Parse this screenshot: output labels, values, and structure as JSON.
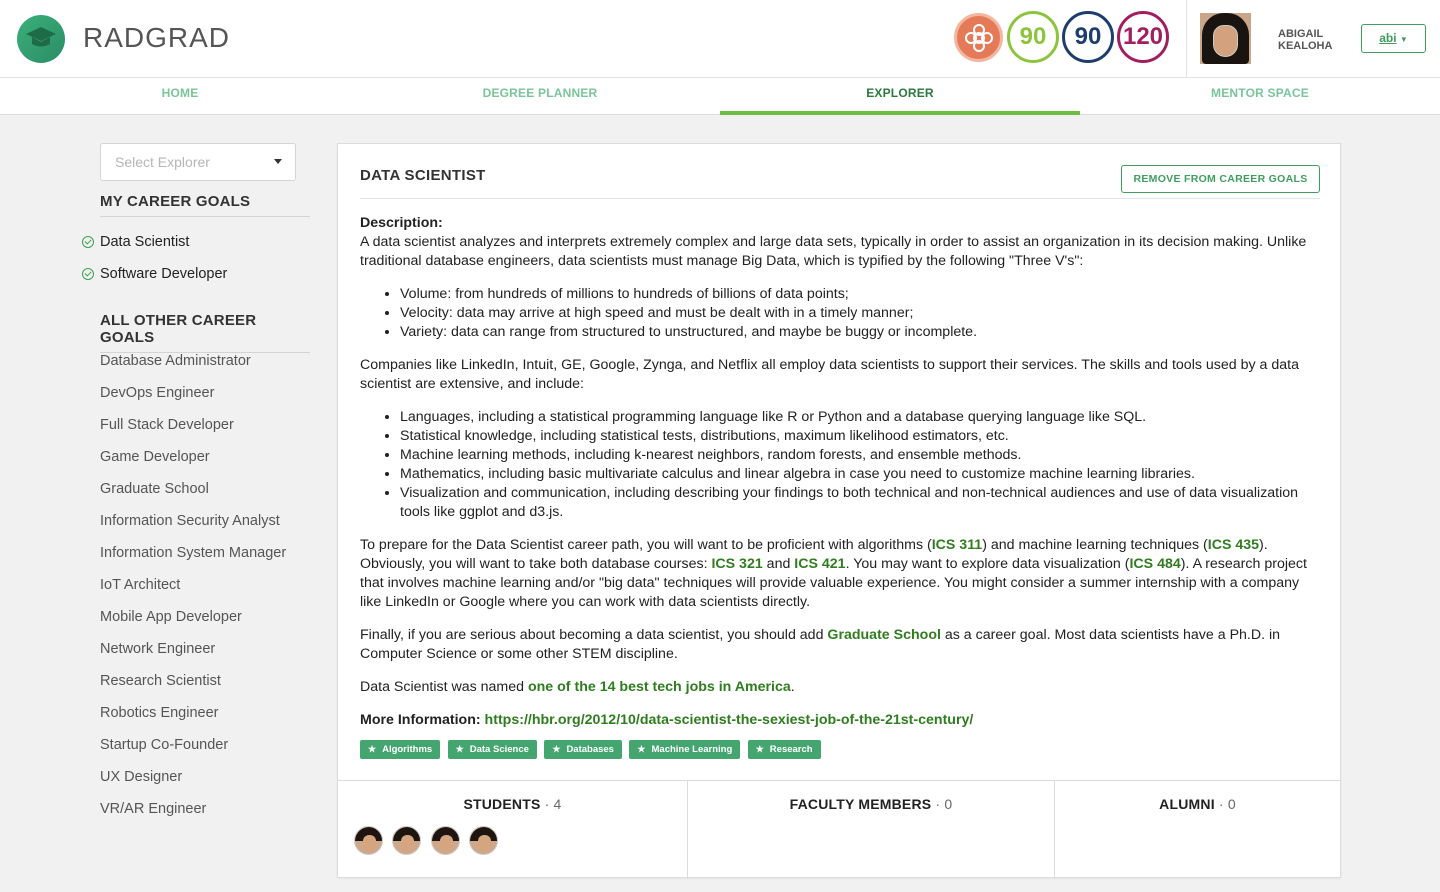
{
  "app": {
    "brand": "RADGRAD",
    "ice": {
      "innovation": "90",
      "competency": "90",
      "experience": "120"
    },
    "user": {
      "name": "ABIGAIL KEALOHA",
      "button": "abi"
    },
    "colors": {
      "accent": "#6fbe44",
      "link": "#2f7d1f",
      "innovation": "#8dc43c",
      "competency": "#1c3d6e",
      "experience": "#a21f5f"
    }
  },
  "nav": [
    {
      "label": "HOME"
    },
    {
      "label": "DEGREE PLANNER"
    },
    {
      "label": "EXPLORER"
    },
    {
      "label": "MENTOR SPACE"
    }
  ],
  "sidebar": {
    "select_placeholder": "Select Explorer",
    "my_goals_heading": "MY CAREER GOALS",
    "my_goals": [
      "Data Scientist",
      "Software Developer"
    ],
    "other_goals_heading": "ALL OTHER CAREER GOALS",
    "other_goals": [
      "Database Administrator",
      "DevOps Engineer",
      "Full Stack Developer",
      "Game Developer",
      "Graduate School",
      "Information Security Analyst",
      "Information System Manager",
      "IoT Architect",
      "Mobile App Developer",
      "Network Engineer",
      "Research Scientist",
      "Robotics Engineer",
      "Startup Co-Founder",
      "UX Designer",
      "VR/AR Engineer"
    ]
  },
  "main": {
    "title": "DATA SCIENTIST",
    "remove_button": "REMOVE FROM CAREER GOALS",
    "description_label": "Description:",
    "p1": "A data scientist analyzes and interprets extremely complex and large data sets, typically in order to assist an organization in its decision making. Unlike traditional database engineers, data scientists must manage Big Data, which is typified by the following \"Three V's\":",
    "list1": [
      "Volume: from hundreds of millions to hundreds of billions of data points;",
      "Velocity: data may arrive at high speed and must be dealt with in a timely manner;",
      "Variety: data can range from structured to unstructured, and maybe be buggy or incomplete."
    ],
    "p2": "Companies like LinkedIn, Intuit, GE, Google, Zynga, and Netflix all employ data scientists to support their services. The skills and tools used by a data scientist are extensive, and include:",
    "list2": [
      "Languages, including a statistical programming language like R or Python and a database querying language like SQL.",
      "Statistical knowledge, including statistical tests, distributions, maximum likelihood estimators, etc.",
      "Machine learning methods, including k-nearest neighbors, random forests, and ensemble methods.",
      "Mathematics, including basic multivariate calculus and linear algebra in case you need to customize machine learning libraries.",
      "Visualization and communication, including describing your findings to both technical and non-technical audiences and use of data visualization tools like ggplot and d3.js."
    ],
    "p3": {
      "t1": "To prepare for the Data Scientist career path, you will want to be proficient with algorithms (",
      "l1": "ICS 311",
      "t2": ") and machine learning techniques (",
      "l2": "ICS 435",
      "t3": "). Obviously, you will want to take both database courses: ",
      "l3": "ICS 321",
      "t4": " and ",
      "l4": "ICS 421",
      "t5": ". You may want to explore data visualization (",
      "l5": "ICS 484",
      "t6": "). A research project that involves machine learning and/or \"big data\" techniques will provide valuable experience. You might consider a summer internship with a company like LinkedIn or Google where you can work with data scientists directly."
    },
    "p4": {
      "t1": "Finally, if you are serious about becoming a data scientist, you should add ",
      "l1": "Graduate School",
      "t2": " as a career goal. Most data scientists have a Ph.D. in Computer Science or some other STEM discipline."
    },
    "p5": {
      "t1": "Data Scientist was named ",
      "l1": "one of the 14 best tech jobs in America",
      "t2": "."
    },
    "more_info_label": "More Information:",
    "more_info_url": "https://hbr.org/2012/10/data-scientist-the-sexiest-job-of-the-21st-century/",
    "tags": [
      "Algorithms",
      "Data Science",
      "Databases",
      "Machine Learning",
      "Research"
    ],
    "students_label": "STUDENTS",
    "students_count": "· 4",
    "faculty_label": "FACULTY MEMBERS",
    "faculty_count": "· 0",
    "alumni_label": "ALUMNI",
    "alumni_count": "· 0"
  }
}
